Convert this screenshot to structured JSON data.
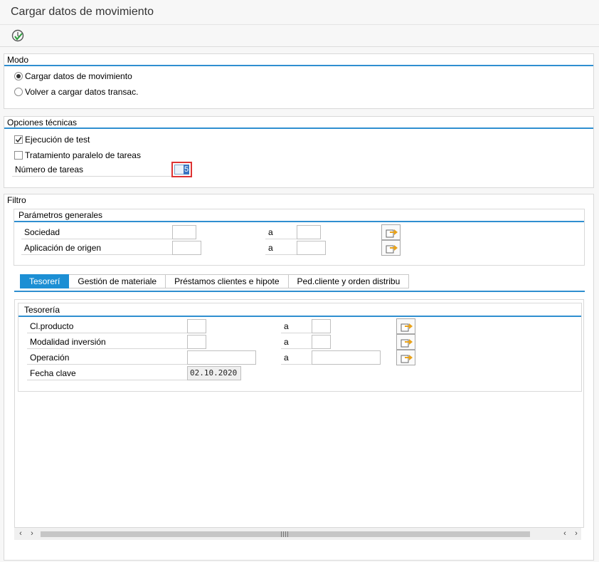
{
  "window": {
    "title": "Cargar datos de movimiento"
  },
  "toolbar": {
    "execute_icon": "execute-clock-icon"
  },
  "modo": {
    "title": "Modo",
    "options": [
      {
        "label": "Cargar datos de movimiento",
        "selected": true
      },
      {
        "label": "Volver a cargar datos transac.",
        "selected": false
      }
    ]
  },
  "opciones": {
    "title": "Opciones técnicas",
    "test_label": "Ejecución de test",
    "test_checked": true,
    "paralelo_label": "Tratamiento paralelo de tareas",
    "paralelo_checked": false,
    "num_tareas_label": "Número de tareas",
    "num_tareas_value": "5"
  },
  "filtro": {
    "title": "Filtro",
    "generales": {
      "title": "Parámetros generales",
      "rows": [
        {
          "label": "Sociedad",
          "to_label": "a",
          "from": "",
          "to": ""
        },
        {
          "label": "Aplicación de origen",
          "to_label": "a",
          "from": "",
          "to": ""
        }
      ]
    },
    "tabs": [
      {
        "label": "Tesorerí",
        "active": true
      },
      {
        "label": "Gestión de materiale",
        "active": false
      },
      {
        "label": "Préstamos clientes e hipote",
        "active": false
      },
      {
        "label": "Ped.cliente y orden distribu",
        "active": false
      }
    ],
    "tesoreria": {
      "title": "Tesorería",
      "rows": [
        {
          "label": "Cl.producto",
          "to_label": "a",
          "from": "",
          "to": ""
        },
        {
          "label": "Modalidad inversión",
          "to_label": "a",
          "from": "",
          "to": ""
        },
        {
          "label": "Operación",
          "to_label": "a",
          "from": "",
          "to": ""
        }
      ],
      "fecha_label": "Fecha clave",
      "fecha_value": "02.10.2020"
    }
  },
  "colors": {
    "accent": "#2f8fd0",
    "tab_active": "#1c8fd4"
  }
}
